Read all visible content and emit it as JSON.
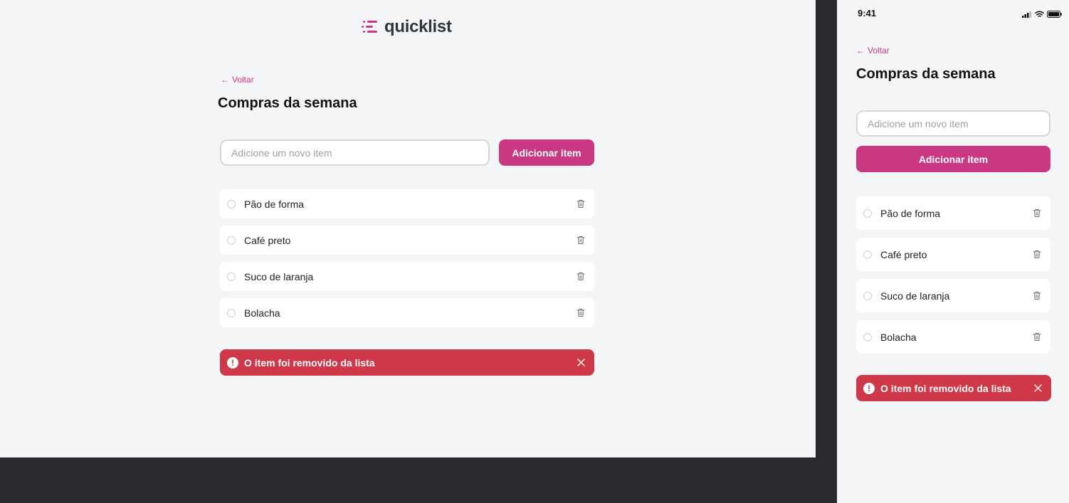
{
  "brand": {
    "name": "quicklist",
    "accent": "#ca3884"
  },
  "desktop": {
    "back_label": "Voltar",
    "title": "Compras da semana",
    "input_placeholder": "Adicione um novo item",
    "add_button_label": "Adicionar item",
    "items": [
      {
        "label": "Pão de forma",
        "checked": false
      },
      {
        "label": "Café preto",
        "checked": false
      },
      {
        "label": "Suco de laranja",
        "checked": false
      },
      {
        "label": "Bolacha",
        "checked": false
      }
    ],
    "toast": {
      "message": "O item foi removido da lista",
      "color": "#ce3848"
    }
  },
  "mobile": {
    "status": {
      "time": "9:41"
    },
    "back_label": "Voltar",
    "title": "Compras da semana",
    "input_placeholder": "Adicione um novo item",
    "add_button_label": "Adicionar item",
    "items": [
      {
        "label": "Pão de forma",
        "checked": false
      },
      {
        "label": "Café preto",
        "checked": false
      },
      {
        "label": "Suco de laranja",
        "checked": false
      },
      {
        "label": "Bolacha",
        "checked": false
      }
    ],
    "toast": {
      "message": "O item foi removido da lista",
      "color": "#ce3848"
    }
  }
}
